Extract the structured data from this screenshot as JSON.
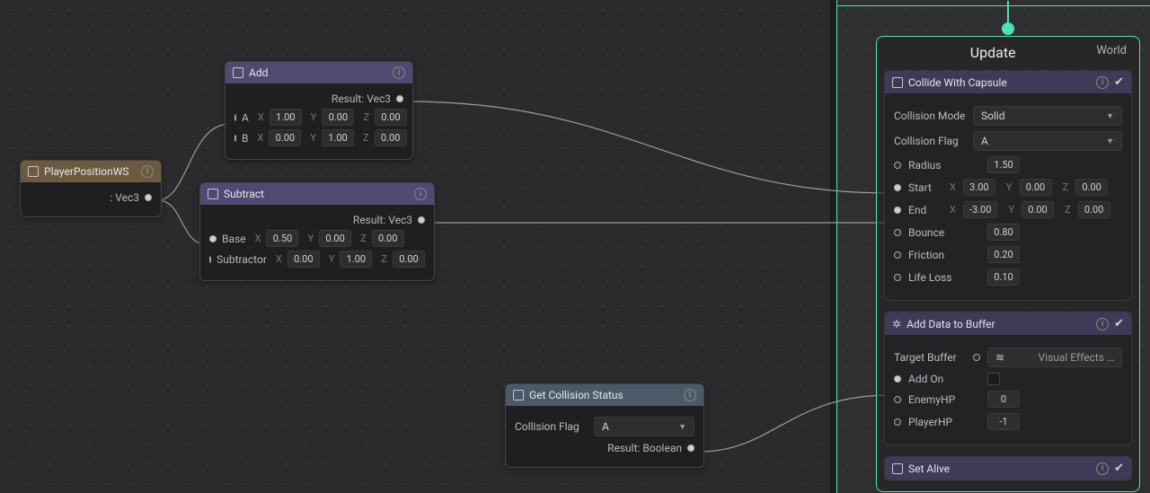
{
  "playerPos": {
    "title": "PlayerPositionWS",
    "outLabel": ": Vec3"
  },
  "add": {
    "title": "Add",
    "result": "Result: Vec3",
    "A": {
      "x": "1.00",
      "y": "0.00",
      "z": "0.00"
    },
    "B": {
      "x": "0.00",
      "y": "1.00",
      "z": "0.00"
    },
    "labelA": "A",
    "labelB": "B"
  },
  "sub": {
    "title": "Subtract",
    "result": "Result: Vec3",
    "baseLabel": "Base",
    "subLabel": "Subtractor",
    "base": {
      "x": "0.50",
      "y": "0.00",
      "z": "0.00"
    },
    "subtr": {
      "x": "0.00",
      "y": "1.00",
      "z": "0.00"
    }
  },
  "getCol": {
    "title": "Get Collision Status",
    "flagLabel": "Collision Flag",
    "flagValue": "A",
    "result": "Result: Boolean"
  },
  "update": {
    "title": "Update",
    "world": "World"
  },
  "collide": {
    "title": "Collide With Capsule",
    "modeLabel": "Collision Mode",
    "modeValue": "Solid",
    "flagLabel": "Collision Flag",
    "flagValue": "A",
    "radiusLabel": "Radius",
    "radius": "1.50",
    "startLabel": "Start",
    "start": {
      "x": "3.00",
      "y": "0.00",
      "z": "0.00"
    },
    "endLabel": "End",
    "end": {
      "x": "-3.00",
      "y": "0.00",
      "z": "0.00"
    },
    "bounceLabel": "Bounce",
    "bounce": "0.80",
    "frictionLabel": "Friction",
    "friction": "0.20",
    "lifeLabel": "Life Loss",
    "life": "0.10"
  },
  "buffer": {
    "title": "Add Data to Buffer",
    "targetLabel": "Target Buffer",
    "targetValue": "Visual Effects …",
    "addOnLabel": "Add On",
    "enemyLabel": "EnemyHP",
    "enemy": "0",
    "playerLabel": "PlayerHP",
    "player": "-1"
  },
  "setAlive": {
    "title": "Set Alive"
  },
  "axis": {
    "x": "X",
    "y": "Y",
    "z": "Z"
  }
}
